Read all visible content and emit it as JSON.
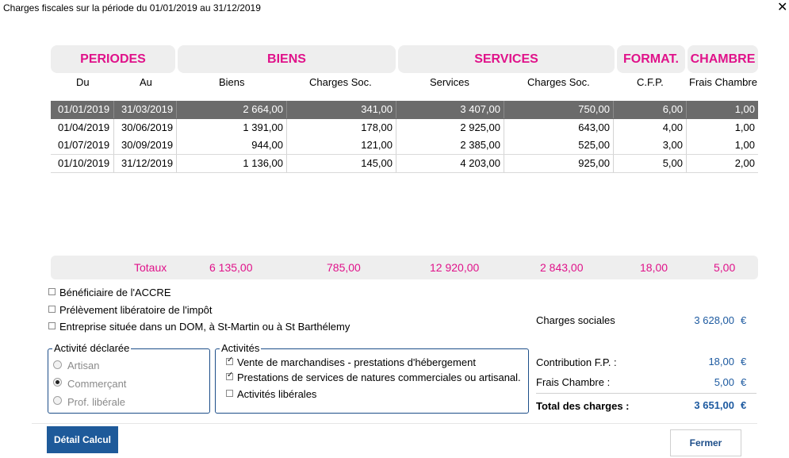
{
  "window": {
    "title": "Charges fiscales sur la période du 01/01/2019 au 31/12/2019",
    "close_glyph": "✕"
  },
  "groups": {
    "periodes": "PERIODES",
    "biens": "BIENS",
    "services": "SERVICES",
    "format": "FORMAT.",
    "chambre": "CHAMBRE"
  },
  "columns": {
    "du": "Du",
    "au": "Au",
    "biens": "Biens",
    "charges_soc_biens": "Charges Soc.",
    "services": "Services",
    "charges_soc_services": "Charges Soc.",
    "cfp": "C.F.P.",
    "frais_chambre": "Frais Chambre"
  },
  "rows": [
    [
      "01/01/2019",
      "31/03/2019",
      "2 664,00",
      "341,00",
      "3 407,00",
      "750,00",
      "6,00",
      "1,00"
    ],
    [
      "01/04/2019",
      "30/06/2019",
      "1 391,00",
      "178,00",
      "2 925,00",
      "643,00",
      "4,00",
      "1,00"
    ],
    [
      "01/07/2019",
      "30/09/2019",
      "944,00",
      "121,00",
      "2 385,00",
      "525,00",
      "3,00",
      "1,00"
    ],
    [
      "01/10/2019",
      "31/12/2019",
      "1 136,00",
      "145,00",
      "4 203,00",
      "925,00",
      "5,00",
      "2,00"
    ]
  ],
  "totals": {
    "label": "Totaux",
    "biens": "6 135,00",
    "charges_soc_biens": "785,00",
    "services": "12 920,00",
    "charges_soc_services": "2 843,00",
    "cfp": "18,00",
    "frais_chambre": "5,00"
  },
  "options": [
    {
      "label": "Bénéficiaire de l'ACCRE",
      "checked": false
    },
    {
      "label": "Prélèvement libératoire de l'impôt",
      "checked": false
    },
    {
      "label": "Entreprise située dans un DOM, à St-Martin ou à St Barthélemy",
      "checked": false
    }
  ],
  "activite_declaree": {
    "legend": "Activité déclarée",
    "options": [
      {
        "label": "Artisan",
        "selected": false
      },
      {
        "label": "Commerçant",
        "selected": true
      },
      {
        "label": "Prof. libérale",
        "selected": false
      }
    ]
  },
  "activites": {
    "legend": "Activités",
    "options": [
      {
        "label": "Vente de marchandises - prestations d'hébergement",
        "checked": true
      },
      {
        "label": "Prestations de services de natures commerciales ou artisanal.",
        "checked": true
      },
      {
        "label": "Activités libérales",
        "checked": false
      }
    ]
  },
  "summary": {
    "charges_sociales": {
      "label": "Charges sociales",
      "value": "3 628,00",
      "currency": "€"
    },
    "contribution_fp": {
      "label": "Contribution F.P. :",
      "value": "18,00",
      "currency": "€"
    },
    "frais_chambre": {
      "label": "Frais Chambre :",
      "value": "5,00",
      "currency": "€"
    },
    "total": {
      "label": "Total des charges :",
      "value": "3 651,00",
      "currency": "€"
    }
  },
  "buttons": {
    "detail": "Détail Calcul",
    "close": "Fermer"
  },
  "colors": {
    "accent": "#e0128a",
    "primary": "#1e5a9a",
    "value_blue": "#1d5aa0",
    "selected_row": "#6b6b6b"
  }
}
